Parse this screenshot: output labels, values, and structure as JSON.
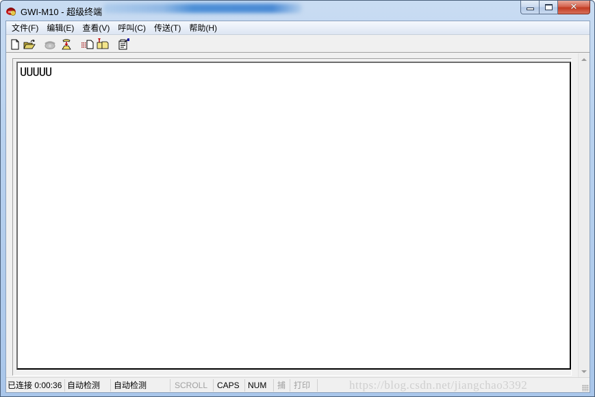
{
  "window": {
    "title": "GWI-M10 - 超级终端",
    "app_icon": "telephone-terminal-icon",
    "controls": {
      "minimize": "minimize-icon",
      "maximize": "maximize-icon",
      "close": "close-icon",
      "close_glyph": "✕"
    }
  },
  "menu": {
    "items": [
      {
        "label": "文件(F)",
        "name": "menu-file"
      },
      {
        "label": "编辑(E)",
        "name": "menu-edit"
      },
      {
        "label": "查看(V)",
        "name": "menu-view"
      },
      {
        "label": "呼叫(C)",
        "name": "menu-call"
      },
      {
        "label": "传送(T)",
        "name": "menu-transfer"
      },
      {
        "label": "帮助(H)",
        "name": "menu-help"
      }
    ]
  },
  "toolbar": {
    "buttons": [
      {
        "icon": "new-document-icon",
        "tooltip": "新建",
        "enabled": true
      },
      {
        "icon": "open-folder-icon",
        "tooltip": "打开",
        "enabled": true
      },
      {
        "icon": "dial-phone-icon",
        "tooltip": "呼叫",
        "enabled": false
      },
      {
        "icon": "disconnect-phone-icon",
        "tooltip": "断开",
        "enabled": true
      },
      {
        "icon": "send-file-icon",
        "tooltip": "发送",
        "enabled": true
      },
      {
        "icon": "receive-file-icon",
        "tooltip": "接收",
        "enabled": true
      },
      {
        "icon": "properties-icon",
        "tooltip": "属性",
        "enabled": true
      }
    ]
  },
  "terminal": {
    "content": "UUUUU"
  },
  "statusbar": {
    "connection": "已连接 0:00:36",
    "detect1": "自动检测",
    "detect2": "自动检测",
    "scroll": "SCROLL",
    "caps": "CAPS",
    "num": "NUM",
    "capture": "捕",
    "print": "打印",
    "watermark": "https://blog.csdn.net/jiangchao3392"
  }
}
